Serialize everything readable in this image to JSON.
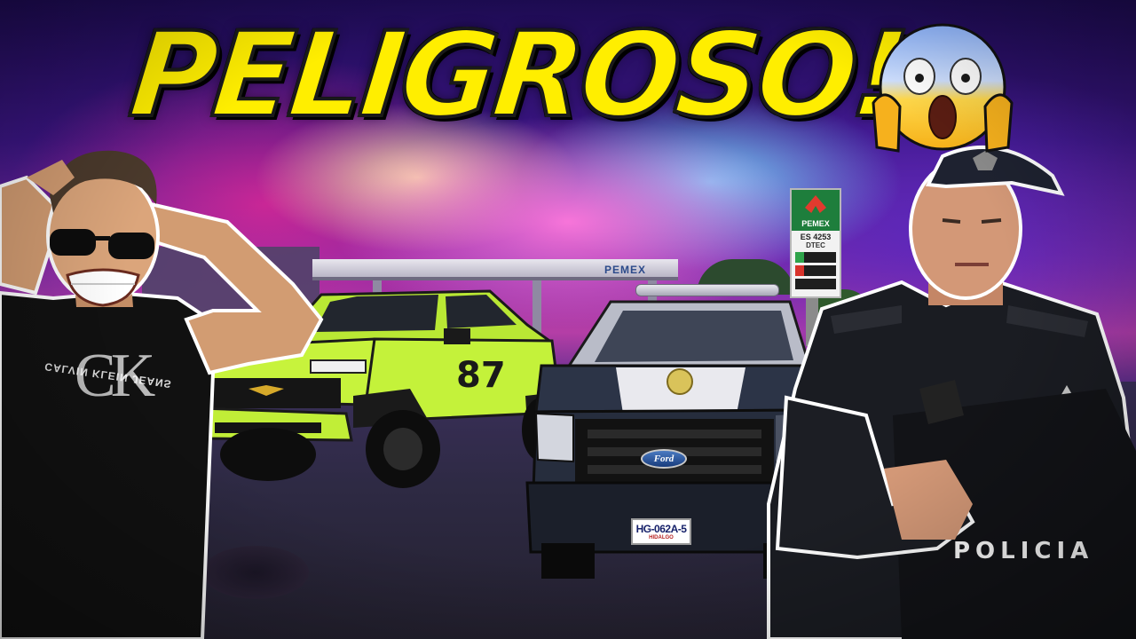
{
  "thumbnail": {
    "title": "PELIGROSO!",
    "emoji_name": "face-screaming-in-fear",
    "title_color": "#ffee00",
    "outline_color": "#1a1a1a"
  },
  "scene": {
    "gas_station_brand": "PEMEX",
    "pump_sign": {
      "brand": "PEMEX",
      "station": "ES 4253",
      "tech": "DTEC"
    },
    "left_person": {
      "shirt_logo": "CK",
      "shirt_text": "CALVIN KLEIN JEANS"
    },
    "chevy_truck": {
      "number": "87",
      "color": "#c4f23a"
    },
    "police_truck": {
      "badge": "Ford",
      "plate": "HG-062A-5",
      "plate_state": "HIDALGO"
    },
    "officer": {
      "vest_text": "POLICIA"
    }
  }
}
